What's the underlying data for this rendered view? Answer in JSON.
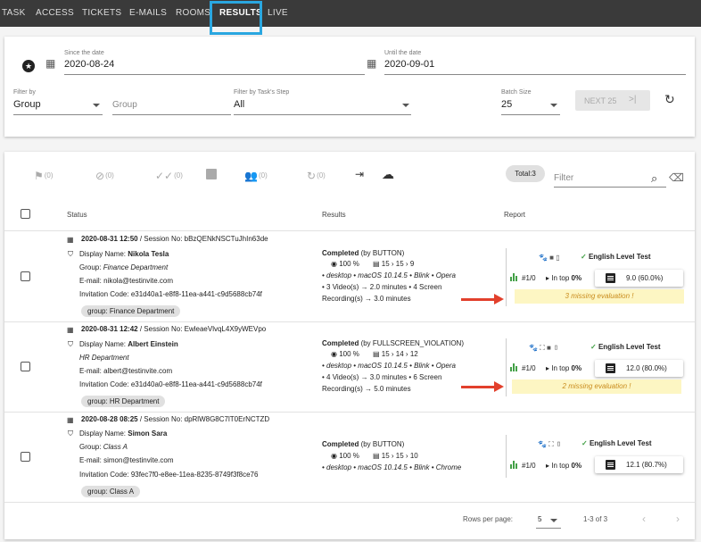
{
  "tabs": [
    "TASK",
    "ACCESS",
    "TICKETS",
    "E-MAILS",
    "ROOMS",
    "RESULTS",
    "LIVE"
  ],
  "filters": {
    "since_label": "Since the date",
    "since_value": "2020-08-24",
    "until_label": "Until the date",
    "until_value": "2020-09-01",
    "filter_by_label": "Filter by",
    "filter_by_value": "Group",
    "group_placeholder": "Group",
    "step_label": "Filter by Task's Step",
    "step_value": "All",
    "batch_label": "Batch Size",
    "batch_value": "25",
    "next_label": "NEXT 25"
  },
  "toolbar": {
    "flag_count": "(0)",
    "block_count": "(0)",
    "check_count": "(0)",
    "group_count": "(0)",
    "refresh_count": "(0)",
    "total": "Total:3",
    "filter_placeholder": "Filter"
  },
  "table": {
    "headers": [
      "Status",
      "Results",
      "Report"
    ]
  },
  "rows": [
    {
      "datetime": "2020-08-31 12:50",
      "session": " / Session No: bBzQENkNSCTuJhIn63de",
      "display_label": "Display Name: ",
      "display_name": "Nikola Tesla",
      "group_label": "Group: ",
      "group": "Finance Department",
      "email": "E-mail: nikola@testinvite.com",
      "invitation": "Invitation Code: e31d40a1-e8f8-11ea-a441-c9d5688cb74f",
      "group_chip": "group: Finance Department",
      "completed": "Completed",
      "completed_by": " (by BUTTON)",
      "percent": "100 %",
      "steps": [
        "15",
        "15",
        "9"
      ],
      "env_a": "• desktop  • ",
      "env_os": "macOS 10.14.5",
      "env_b": " • Blink  • ",
      "env_browser": "Opera",
      "videos": "• 3 Video(s) → 2.0 minutes  • 4 Screen",
      "recording": "Recording(s) → 3.0 minutes",
      "test_name": "English Level Test",
      "rank": "#1/0",
      "in_top_label": "In top ",
      "in_top_value": "0%",
      "score": "9.0 (60.0%)",
      "missing": "3 missing evaluation !"
    },
    {
      "datetime": "2020-08-31 12:42",
      "session": " / Session No: EwleaeVlvqL4X9yWEVpo",
      "display_label": "Display Name: ",
      "display_name": "Albert Einstein",
      "group_label": "",
      "group": "HR Department",
      "email": "E-mail: albert@testinvite.com",
      "invitation": "Invitation Code: e31d40a0-e8f8-11ea-a441-c9d5688cb74f",
      "group_chip": "group: HR Department",
      "completed": "Completed",
      "completed_by": " (by FULLSCREEN_VIOLATION)",
      "percent": "100 %",
      "steps": [
        "15",
        "14",
        "12"
      ],
      "env_a": "• desktop  • ",
      "env_os": "macOS 10.14.5",
      "env_b": " • Blink  • ",
      "env_browser": "Opera",
      "videos": "• 4 Video(s) → 3.0 minutes  • 6 Screen",
      "recording": "Recording(s) → 5.0 minutes",
      "test_name": "English Level Test",
      "rank": "#1/0",
      "in_top_label": "In top ",
      "in_top_value": "0%",
      "score": "12.0 (80.0%)",
      "missing": "2 missing evaluation !"
    },
    {
      "datetime": "2020-08-28 08:25",
      "session": " / Session No: dpRlW8G8C7lT0ErNCTZD",
      "display_label": "Display Name: ",
      "display_name": "Simon Sara",
      "group_label": "Group: ",
      "group": "Class A",
      "email": "E-mail: simon@testinvite.com",
      "invitation": "Invitation Code: 93fec7f0-e8ee-11ea-8235-8749f3f8ce76",
      "group_chip": "group: Class A",
      "completed": "Completed",
      "completed_by": " (by BUTTON)",
      "percent": "100 %",
      "steps": [
        "15",
        "15",
        "10"
      ],
      "env_a": "• desktop  • ",
      "env_os": "macOS 10.14.5",
      "env_b": " • Blink  • ",
      "env_browser": "Chrome",
      "videos": "",
      "recording": "",
      "test_name": "English Level Test",
      "rank": "#1/0",
      "in_top_label": "In top ",
      "in_top_value": "0%",
      "score": "12.1 (80.7%)",
      "missing": ""
    }
  ],
  "footer": {
    "rows_per_page_label": "Rows per page:",
    "rows_per_page_value": "5",
    "range": "1-3 of 3"
  },
  "colors": {
    "highlight": "#2aa7e0",
    "arrow": "#e2402c",
    "missing_bg": "#fdf6c3",
    "ok_green": "#43a047"
  }
}
